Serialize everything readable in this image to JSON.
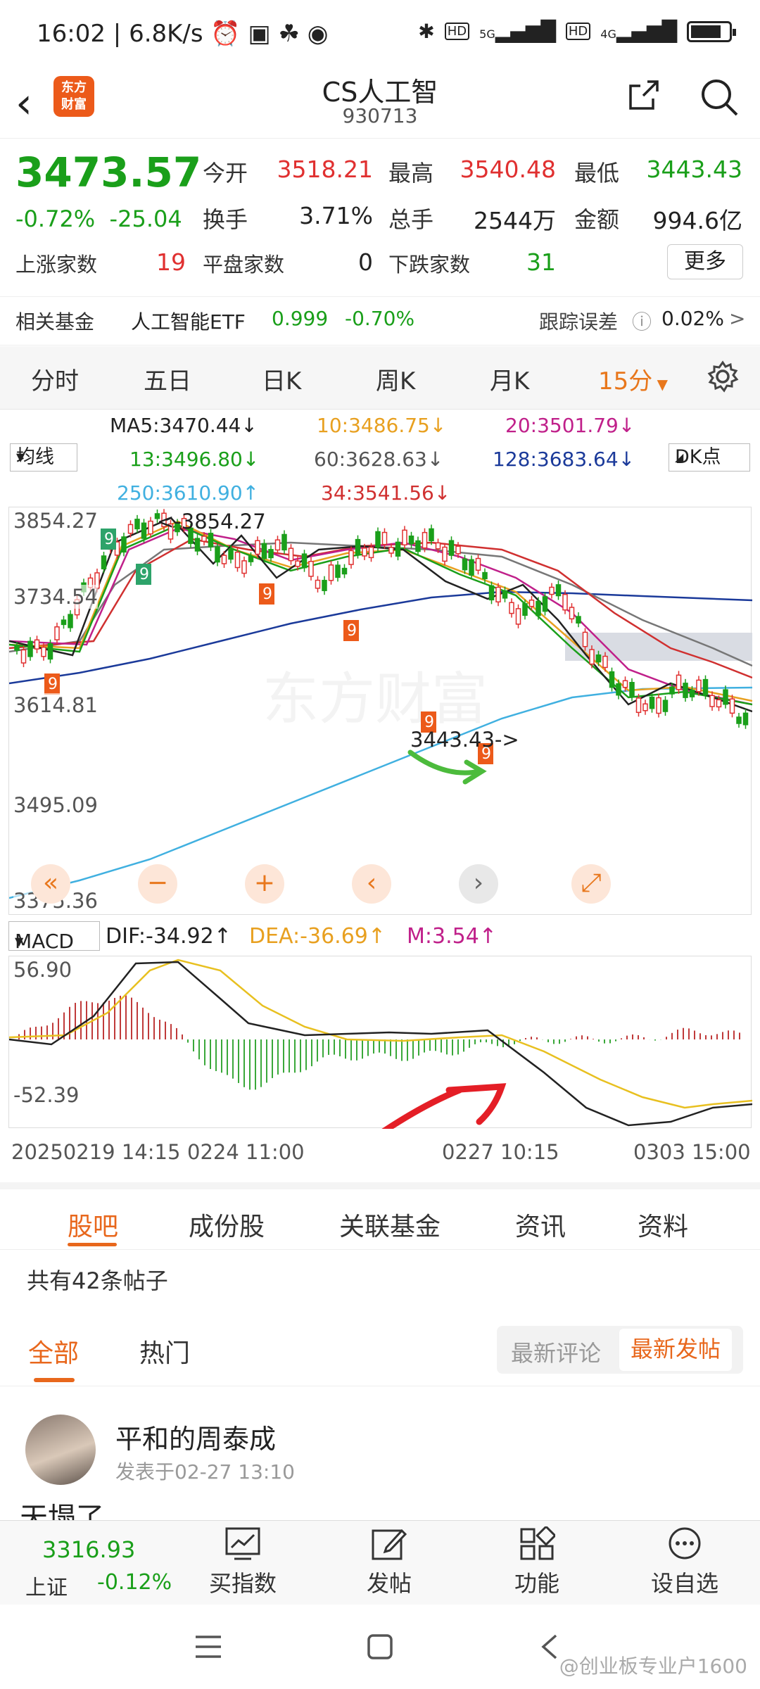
{
  "status": {
    "time": "16:02",
    "speed": "6.8K/s",
    "net1": "5G",
    "net2": "4G",
    "hd1": "HD",
    "hd2": "HD",
    "battery_level": 0.8
  },
  "header": {
    "app_logo": "东方\n财富",
    "title": "CS人工智",
    "code": "930713"
  },
  "quote": {
    "price": "3473.57",
    "pct": "-0.72%",
    "change": "-25.04",
    "open_label": "今开",
    "open": "3518.21",
    "high_label": "最高",
    "high": "3540.48",
    "low_label": "最低",
    "low": "3443.43",
    "turnover_label": "换手",
    "turnover": "3.71%",
    "volume_label": "总手",
    "volume": "2544万",
    "amount_label": "金额",
    "amount": "994.6亿",
    "up_label": "上涨家数",
    "up": "19",
    "flat_label": "平盘家数",
    "flat": "0",
    "down_label": "下跌家数",
    "down": "31",
    "more": "更多"
  },
  "fund": {
    "label": "相关基金",
    "name": "人工智能ETF",
    "price": "0.999",
    "pct": "-0.70%",
    "track_label": "跟踪误差",
    "track": "0.02%",
    "arrow": ">"
  },
  "tabs": [
    "分时",
    "五日",
    "日K",
    "周K",
    "月K",
    "15分"
  ],
  "ma": {
    "btn": "均线",
    "dk": "DK点",
    "ma5": "MA5:3470.44↓",
    "ma10": "10:3486.75↓",
    "ma20": "20:3501.79↓",
    "ma13": "13:3496.80↓",
    "ma60": "60:3628.63↓",
    "ma128": "128:3683.64↓",
    "ma250": "250:3610.90↑",
    "ma34": "34:3541.56↓"
  },
  "kchart": {
    "y_labels": [
      "3854.27",
      "3734.54",
      "3614.81",
      "3495.09",
      "3375.36"
    ],
    "high_marker": "<-3854.27",
    "low_marker": "3443.43->",
    "watermark": "东方财富",
    "controls": [
      "«",
      "−",
      "+",
      "‹",
      "›",
      "⤢"
    ]
  },
  "macd": {
    "btn": "MACD",
    "dif": "DIF:-34.92↑",
    "dea": "DEA:-36.69↑",
    "m": "M:3.54↑",
    "top": "56.90",
    "bottom": "-52.39"
  },
  "dates": [
    "20250219 14:15",
    "0224 11:00",
    "0227 10:15",
    "0303 15:00"
  ],
  "section_tabs": [
    "股吧",
    "成份股",
    "关联基金",
    "资讯",
    "资料"
  ],
  "posts": {
    "count": "共有42条帖子",
    "tab_all": "全部",
    "tab_hot": "热门",
    "sort_comment": "最新评论",
    "sort_post": "最新发帖",
    "author": "平和的周泰成",
    "time": "发表于02-27 13:10",
    "body": "天塌了"
  },
  "bottom": {
    "sh_price": "3316.93",
    "sh_name": "上证",
    "sh_pct": "-0.12%",
    "items": [
      "买指数",
      "发帖",
      "功能",
      "设自选"
    ]
  },
  "watermark": "@创业板专业户1600",
  "chart_data": {
    "type": "candlestick",
    "price_range": [
      3375.36,
      3854.27
    ],
    "high": 3854.27,
    "low": 3443.43,
    "close": 3473.57
  }
}
